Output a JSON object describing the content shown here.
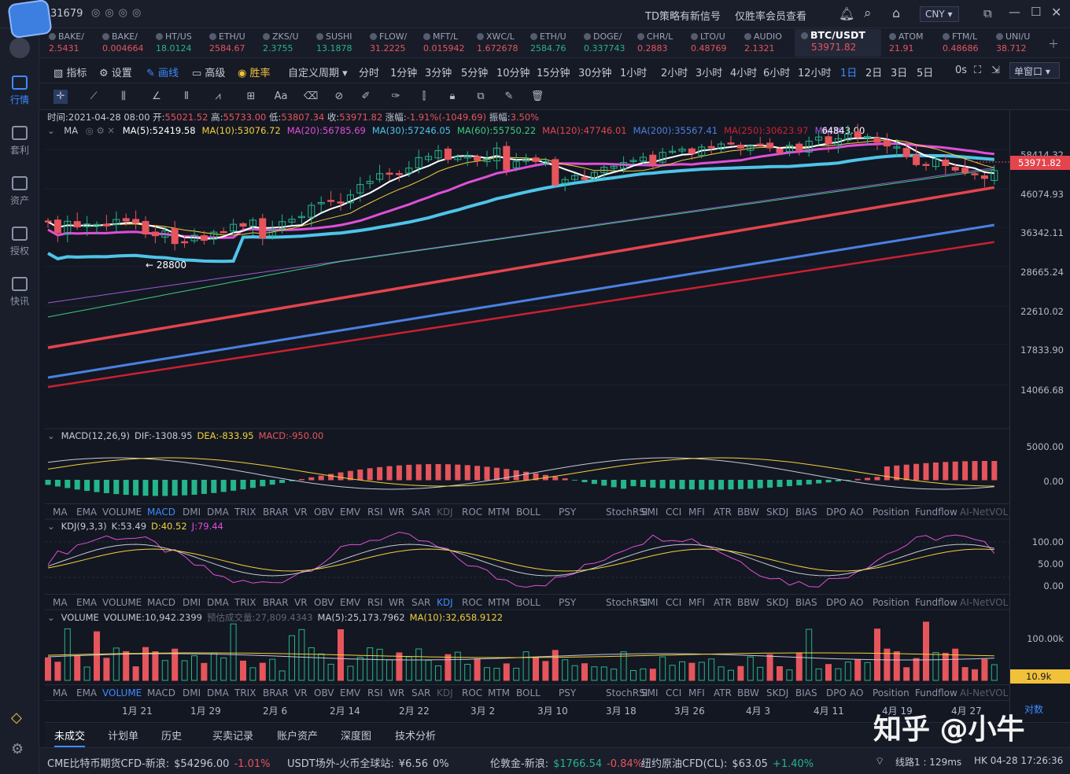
{
  "titlebar": {
    "app_id": "31679",
    "notice": "TD策略有新信号",
    "notice_sub": "仅胜率会员查看",
    "currency": "CNY"
  },
  "sidebar": [
    {
      "label": "行情"
    },
    {
      "label": "套利"
    },
    {
      "label": "资产"
    },
    {
      "label": "授权"
    },
    {
      "label": "快讯"
    }
  ],
  "tickers": [
    {
      "name": "BAKE/",
      "price": "2.5431",
      "up": false
    },
    {
      "name": "BAKE/",
      "price": "0.004664",
      "up": false
    },
    {
      "name": "HT/US",
      "price": "18.0124",
      "up": true
    },
    {
      "name": "ETH/U",
      "price": "2584.67",
      "up": false
    },
    {
      "name": "ZKS/U",
      "price": "2.3755",
      "up": true
    },
    {
      "name": "SUSHI",
      "price": "13.1878",
      "up": true
    },
    {
      "name": "FLOW/",
      "price": "31.2225",
      "up": false
    },
    {
      "name": "MFT/L",
      "price": "0.015942",
      "up": false
    },
    {
      "name": "XWC/L",
      "price": "1.672678",
      "up": false
    },
    {
      "name": "ETH/U",
      "price": "2584.76",
      "up": true
    },
    {
      "name": "DOGE/",
      "price": "0.337743",
      "up": true
    },
    {
      "name": "CHR/L",
      "price": "0.2883",
      "up": false
    },
    {
      "name": "LTO/U",
      "price": "0.48769",
      "up": false
    },
    {
      "name": "AUDIO",
      "price": "2.1321",
      "up": false
    },
    {
      "name": "BTC/USDT",
      "price": "53971.82",
      "up": false,
      "active": true
    },
    {
      "name": "ATOM",
      "price": "21.91",
      "up": false
    },
    {
      "name": "FTM/L",
      "price": "0.48686",
      "up": false
    },
    {
      "name": "UNI/U",
      "price": "38.712",
      "up": false
    }
  ],
  "toolbar": {
    "indicator": "指标",
    "settings": "设置",
    "draw": "画线",
    "advanced": "高级",
    "winrate": "胜率",
    "custom": "自定义周期",
    "periods": [
      "分时",
      "1分钟",
      "3分钟",
      "5分钟",
      "10分钟",
      "15分钟",
      "30分钟",
      "1小时",
      "2小时",
      "3小时",
      "4小时",
      "6小时",
      "12小时",
      "1日",
      "2日",
      "3日",
      "5日"
    ],
    "active_period": "1日",
    "countdown": "0s",
    "window": "单窗口"
  },
  "ohlc": {
    "time_label": "时间:",
    "time": "2021-04-28 08:00",
    "open_label": "开:",
    "open": "55021.52",
    "high_label": "高:",
    "high": "55733.00",
    "low_label": "低:",
    "low": "53807.34",
    "close_label": "收:",
    "close": "53971.82",
    "chg_label": "涨幅:",
    "chg": "-1.91%(-1049.69)",
    "amp_label": "振幅:",
    "amp": "3.50%"
  },
  "ma": {
    "name": "MA",
    "values": [
      {
        "label": "MA(5):52419.58",
        "color": "#ffffff"
      },
      {
        "label": "MA(10):53076.72",
        "color": "#f2d13a"
      },
      {
        "label": "MA(20):56785.69",
        "color": "#e04fd8"
      },
      {
        "label": "MA(30):57246.05",
        "color": "#4fc4e8"
      },
      {
        "label": "MA(60):55750.22",
        "color": "#3ccc7e"
      },
      {
        "label": "MA(120):47746.01",
        "color": "#e5444c"
      },
      {
        "label": "MA(200):35567.41",
        "color": "#4a80e0"
      },
      {
        "label": "MA(250):30623.97",
        "color": "#cc2030"
      },
      {
        "label": "MA(36",
        "color": "#9b59d9"
      }
    ],
    "overlay": "64843.00"
  },
  "price_axis": [
    "58414.32",
    "46074.93",
    "36342.11",
    "28665.24",
    "22610.02",
    "17833.90",
    "14066.68"
  ],
  "last_price": "53971.82",
  "low_annotation": "← 28800",
  "macd": {
    "name": "MACD(12,26,9)",
    "dif": "DIF:-1308.95",
    "dea": "DEA:-833.95",
    "macd": "MACD:-950.00",
    "axis": [
      "5000.00",
      "0.00"
    ]
  },
  "kdj": {
    "name": "KDJ(9,3,3)",
    "k": "K:53.49",
    "d": "D:40.52",
    "j": "J:79.44",
    "axis": [
      "100.00",
      "50.00",
      "0.00"
    ]
  },
  "volume": {
    "name": "VOLUME",
    "vol": "VOLUME:10,942.2399",
    "est": "预估成交量:27,809.4343",
    "ma5": "MA(5):25,173.7962",
    "ma10": "MA(10):32,658.9122",
    "axis": [
      "100.00k"
    ],
    "last": "10.9k"
  },
  "ind_tabs": [
    "MA",
    "EMA",
    "VOLUME",
    "MACD",
    "DMI",
    "DMA",
    "TRIX",
    "BRAR",
    "VR",
    "OBV",
    "EMV",
    "RSI",
    "WR",
    "SAR",
    "KDJ",
    "ROC",
    "MTM",
    "BOLL",
    "PSY",
    "StochRSI",
    "SMI",
    "CCI",
    "MFI",
    "ATR",
    "BBW",
    "SKDJ",
    "BIAS",
    "DPO",
    "AO",
    "Position",
    "Fundflow",
    "AI-NetVOL"
  ],
  "dates": [
    "1月 21",
    "1月 29",
    "2月 6",
    "2月 14",
    "2月 22",
    "3月 2",
    "3月 10",
    "3月 18",
    "3月 26",
    "4月 3",
    "4月 11",
    "4月 19",
    "4月 27"
  ],
  "axis_mode": "对数",
  "bottom_tabs": [
    "未成交",
    "计划单",
    "历史",
    "买卖记录",
    "账户资产",
    "深度图",
    "技术分析"
  ],
  "status": [
    {
      "label": "CME比特币期货CFD-新浪:",
      "price": "$54296.00",
      "chg": "-1.01%",
      "up": false
    },
    {
      "label": "USDT场外-火币全球站:",
      "price": "¥6.56",
      "chg": "0%",
      "up": null
    },
    {
      "label": "伦敦金-新浪:",
      "price": "$1766.54",
      "chg": "-0.84%",
      "up": false
    },
    {
      "label": "纽约原油CFD(CL):",
      "price": "$63.05",
      "chg": "+1.40%",
      "up": true
    }
  ],
  "network": "线路1 : 129ms",
  "clock": "HK 04-28 17:26:36",
  "watermark": "知乎 @小牛"
}
